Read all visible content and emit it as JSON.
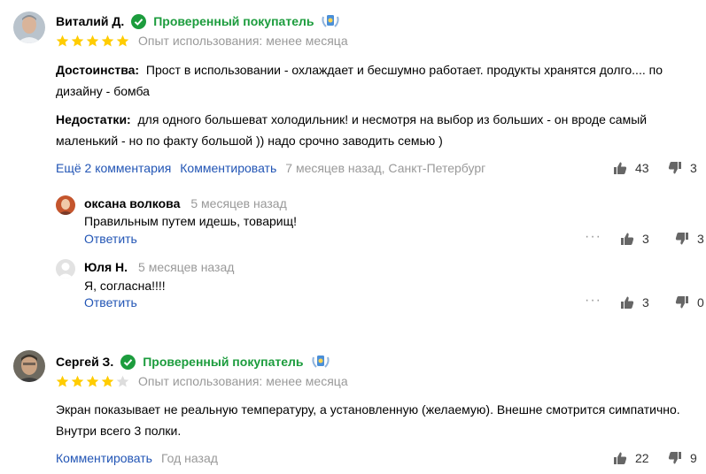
{
  "reviews": [
    {
      "author": "Виталий Д.",
      "verified": "Проверенный покупатель",
      "experience": "Опыт использования: менее месяца",
      "rating": 5,
      "pros_label": "Достоинства:",
      "pros_line1": "Прост в использовании - охлаждает и бесшумно работает. продукты хранятся долго.... по",
      "pros_line2": "дизайну - бомба",
      "cons_label": "Недостатки:",
      "cons_line1": "для одного большеват холодильник! и несмотря на выбор из больших - он вроде самый",
      "cons_line2": "маленький - но по факту большой )) надо срочно заводить семью )",
      "more_comments": "Ещё 2 комментария",
      "comment_action": "Комментировать",
      "meta": "7 месяцев назад, Санкт-Петербург",
      "likes": "43",
      "dislikes": "3"
    },
    {
      "author": "Сергей З.",
      "verified": "Проверенный покупатель",
      "experience": "Опыт использования: менее месяца",
      "rating": 4,
      "text_line1": "Экран показывает не реальную температуру, а установленную (желаемую). Внешне смотрится симпатично.",
      "text_line2": "Внутри всего 3 полки.",
      "comment_action": "Комментировать",
      "meta": "Год назад",
      "likes": "22",
      "dislikes": "9"
    }
  ],
  "comments": [
    {
      "author": "оксана волкова",
      "time": "5 месяцев назад",
      "text": "Правильным путем идешь, товарищ!",
      "reply": "Ответить",
      "likes": "3",
      "dislikes": "3"
    },
    {
      "author": "Юля Н.",
      "time": "5 месяцев назад",
      "text": "Я, согласна!!!!",
      "reply": "Ответить",
      "likes": "3",
      "dislikes": "0"
    }
  ],
  "icons": {
    "verified": "check-circle-icon",
    "badge": "laurel-badge-icon",
    "like": "thumbs-up-icon",
    "dislike": "thumbs-down-icon",
    "more": "more-dots-icon"
  },
  "colors": {
    "verified": "#1c9c3d",
    "link": "#2255b5",
    "star": "#fc0",
    "star_empty": "#ddd",
    "meta": "#999"
  }
}
